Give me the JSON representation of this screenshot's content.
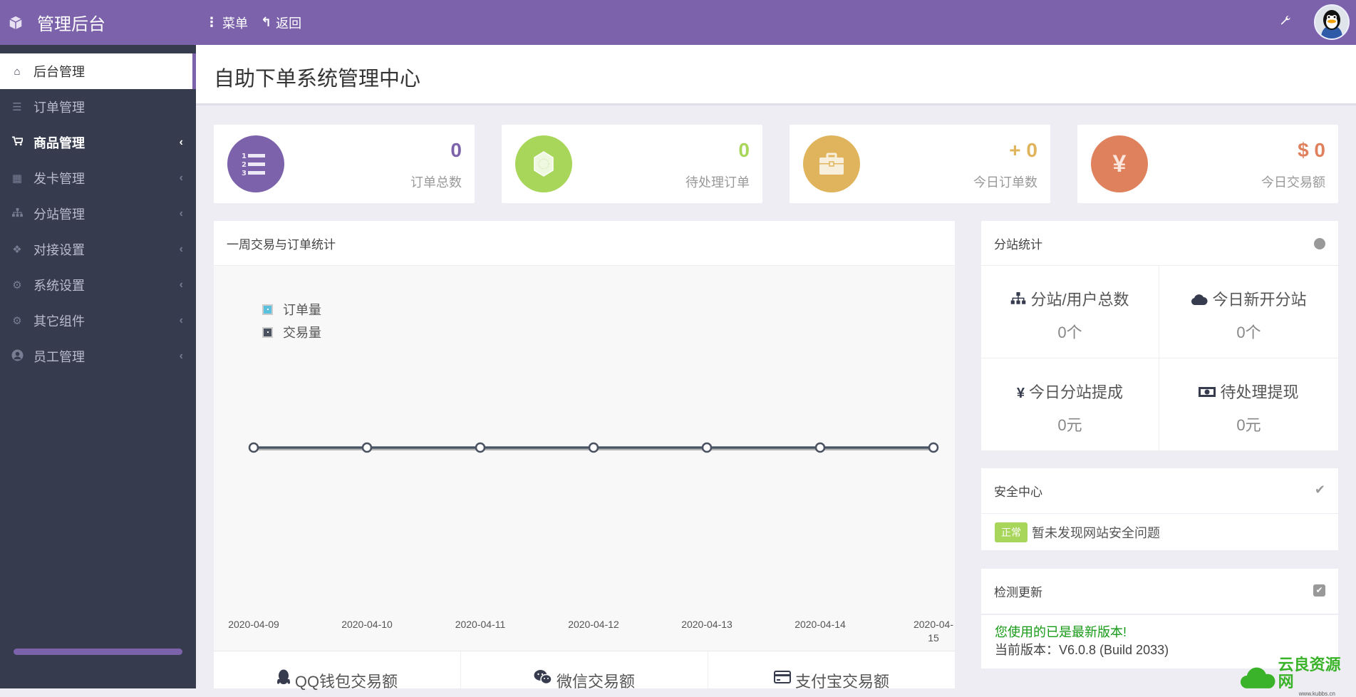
{
  "topbar": {
    "app_title": "管理后台",
    "menu_label": "菜单",
    "back_label": "返回"
  },
  "sidebar": {
    "items": [
      {
        "label": "后台管理",
        "icon": "home-icon"
      },
      {
        "label": "订单管理",
        "icon": "list-icon"
      },
      {
        "label": "商品管理",
        "icon": "cart-icon"
      },
      {
        "label": "发卡管理",
        "icon": "grid-icon"
      },
      {
        "label": "分站管理",
        "icon": "sitemap-icon"
      },
      {
        "label": "对接设置",
        "icon": "cubes-icon"
      },
      {
        "label": "系统设置",
        "icon": "gear-icon"
      },
      {
        "label": "其它组件",
        "icon": "gears-icon"
      },
      {
        "label": "员工管理",
        "icon": "user-circle-icon"
      }
    ]
  },
  "page": {
    "title": "自助下单系统管理中心"
  },
  "stats": [
    {
      "value": "0",
      "label": "订单总数",
      "color": "#7c62ab"
    },
    {
      "value": "0",
      "label": "待处理订单",
      "color": "#a8d65a"
    },
    {
      "value": "+ 0",
      "label": "今日订单数",
      "color": "#e0b45c"
    },
    {
      "value": "$ 0",
      "label": "今日交易额",
      "color": "#e0815e"
    }
  ],
  "chart_panel": {
    "title": "一周交易与订单统计"
  },
  "chart_data": {
    "type": "line",
    "title": "一周交易与订单统计",
    "x": [
      "2020-04-09",
      "2020-04-10",
      "2020-04-11",
      "2020-04-12",
      "2020-04-13",
      "2020-04-14",
      "2020-04-15"
    ],
    "series": [
      {
        "name": "订单量",
        "values": [
          0,
          0,
          0,
          0,
          0,
          0,
          0
        ],
        "color": "#5bc0de"
      },
      {
        "name": "交易量",
        "values": [
          0,
          0,
          0,
          0,
          0,
          0,
          0
        ],
        "color": "#4a5160"
      }
    ],
    "legend": "top-left",
    "grid": false
  },
  "payments": [
    {
      "label": "QQ钱包交易额",
      "icon": "qq-icon"
    },
    {
      "label": "微信交易额",
      "icon": "wechat-icon"
    },
    {
      "label": "支付宝交易额",
      "icon": "credit-card-icon"
    }
  ],
  "substation": {
    "title": "分站统计",
    "cells": [
      {
        "label": "分站/用户总数",
        "value": "0个",
        "icon": "sitemap-icon"
      },
      {
        "label": "今日新开分站",
        "value": "0个",
        "icon": "cloud-icon"
      },
      {
        "label": "今日分站提成",
        "value": "0元",
        "icon": "yen-icon"
      },
      {
        "label": "待处理提现",
        "value": "0元",
        "icon": "money-icon"
      }
    ]
  },
  "security": {
    "title": "安全中心",
    "badge": "正常",
    "message": "暂未发现网站安全问题"
  },
  "update": {
    "title": "检测更新",
    "status": "您使用的已是最新版本!",
    "version": "当前版本：V6.0.8 (Build 2033)"
  },
  "watermark": {
    "text": "云良资源网",
    "sub": "www.kubbs.cn"
  }
}
